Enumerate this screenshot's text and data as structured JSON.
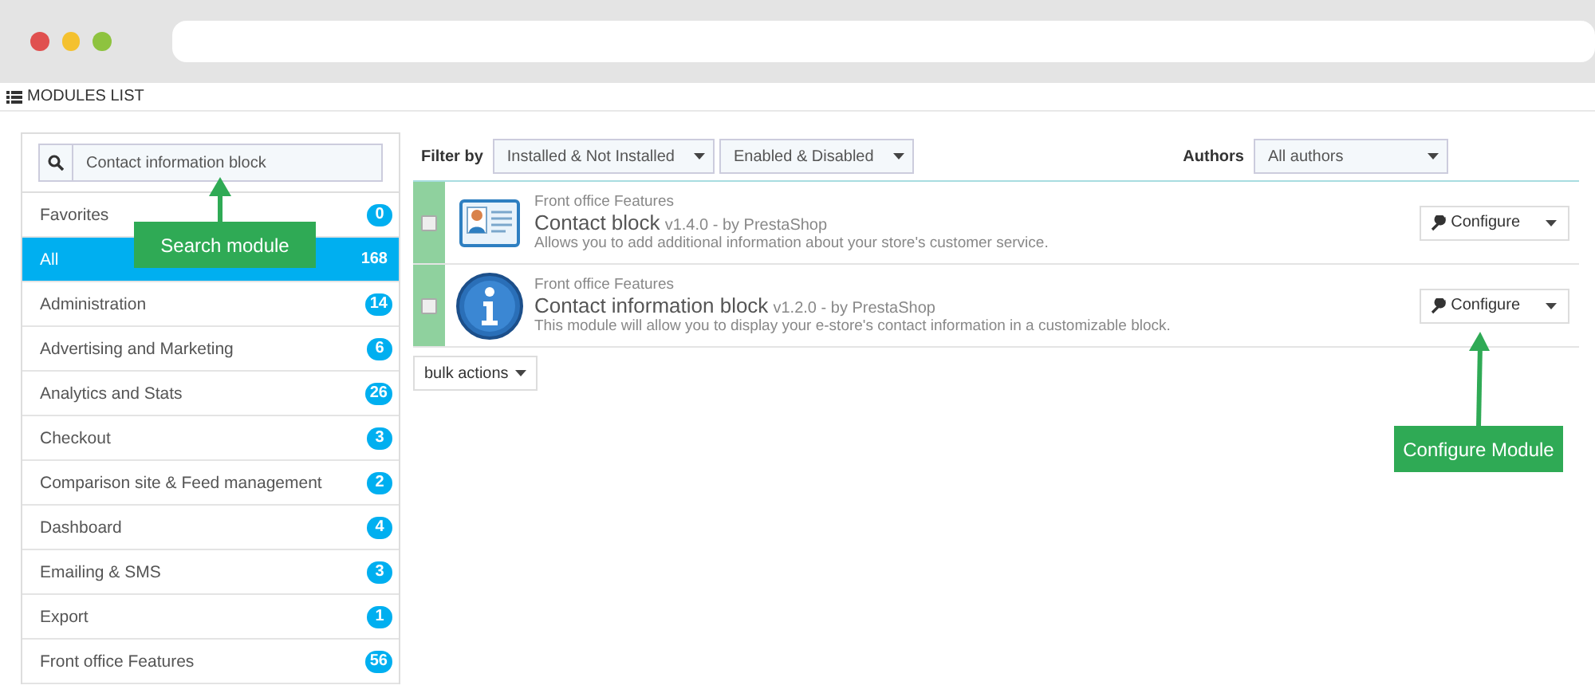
{
  "header": {
    "title": "MODULES LIST"
  },
  "search": {
    "value": "Contact information block"
  },
  "categories": [
    {
      "name": "Favorites",
      "count": "0",
      "selected": false
    },
    {
      "name": "All",
      "count": "168",
      "selected": true
    },
    {
      "name": "Administration",
      "count": "14",
      "selected": false
    },
    {
      "name": "Advertising and Marketing",
      "count": "6",
      "selected": false
    },
    {
      "name": "Analytics and Stats",
      "count": "26",
      "selected": false
    },
    {
      "name": "Checkout",
      "count": "3",
      "selected": false
    },
    {
      "name": "Comparison site & Feed management",
      "count": "2",
      "selected": false
    },
    {
      "name": "Dashboard",
      "count": "4",
      "selected": false
    },
    {
      "name": "Emailing & SMS",
      "count": "3",
      "selected": false
    },
    {
      "name": "Export",
      "count": "1",
      "selected": false
    },
    {
      "name": "Front office Features",
      "count": "56",
      "selected": false
    }
  ],
  "filters": {
    "label": "Filter by",
    "selects": [
      "Installed & Not Installed",
      "Enabled & Disabled"
    ],
    "authors_label": "Authors",
    "authors_select": "All authors"
  },
  "modules": [
    {
      "kind": "card",
      "category": "Front office Features",
      "name": "Contact block",
      "version": "v1.4.0 - by PrestaShop",
      "description": "Allows you to add additional information about your store's customer service.",
      "checked": false,
      "button": "Configure"
    },
    {
      "kind": "info",
      "category": "Front office Features",
      "name": "Contact information block",
      "version": "v1.2.0 - by PrestaShop",
      "description": "This module will allow you to display your e-store's contact information in a customizable block.",
      "checked": false,
      "button": "Configure"
    }
  ],
  "bulk_actions": "bulk actions",
  "annotations": [
    {
      "kind": "search",
      "text": "Search module"
    },
    {
      "kind": "configure",
      "text": "Configure Module"
    }
  ]
}
